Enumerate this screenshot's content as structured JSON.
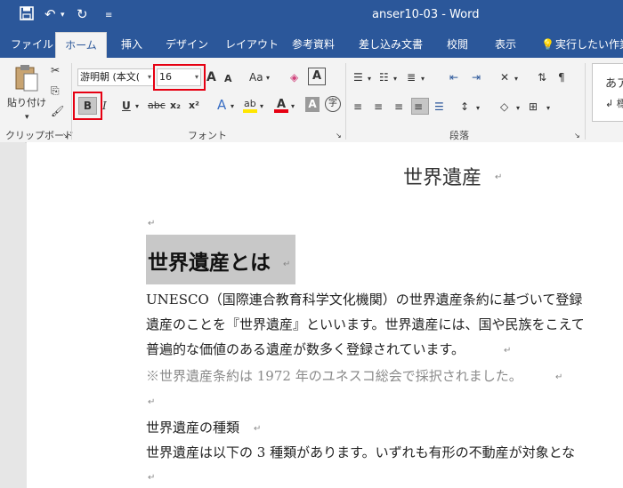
{
  "titlebar": {
    "title": "anser10-03 - Word",
    "save_icon": "save-icon",
    "undo_icon": "undo-icon",
    "redo_icon": "redo-icon",
    "customize_icon": "customize-qat-icon"
  },
  "tabs": [
    "ファイル",
    "ホーム",
    "挿入",
    "デザイン",
    "レイアウト",
    "参考資料",
    "差し込み文書",
    "校閲",
    "表示"
  ],
  "tell_me": "実行したい作業",
  "ribbon": {
    "paste_label": "貼り付け",
    "font_name": "游明朝 (本文(",
    "font_size": "16",
    "clipboard_label": "クリップボード",
    "font_group_label": "フォント",
    "paragraph_group_label": "段落",
    "case_label": "Aa",
    "bold": "B",
    "italic": "I",
    "underline": "U",
    "strike": "abc",
    "sub": "x₂",
    "sup": "x²",
    "grow": "A",
    "shrink": "A",
    "style_preview": "あア",
    "style_sub": "↲ 標"
  },
  "document": {
    "title": "世界遺産",
    "heading": "世界遺産とは",
    "lines": [
      "UNESCO（国際連合教育科学文化機関）の世界遺産条約に基づいて登録",
      "遺産のことを『世界遺産』といいます。世界遺産には、国や民族をこえて",
      "普遍的な価値のある遺産が数多く登録されています。"
    ],
    "note": "※世界遺産条約は 1972 年のユネスコ総会で採択されました。",
    "section_heading": "世界遺産の種類",
    "section_line": "世界遺産は以下の 3 種類があります。いずれも有形の不動産が対象とな"
  },
  "colors": {
    "title_bar": "#2b579a",
    "highlight_box": "#e60012",
    "selection": "#c8c8c8",
    "note_text": "#8a8a8a"
  }
}
